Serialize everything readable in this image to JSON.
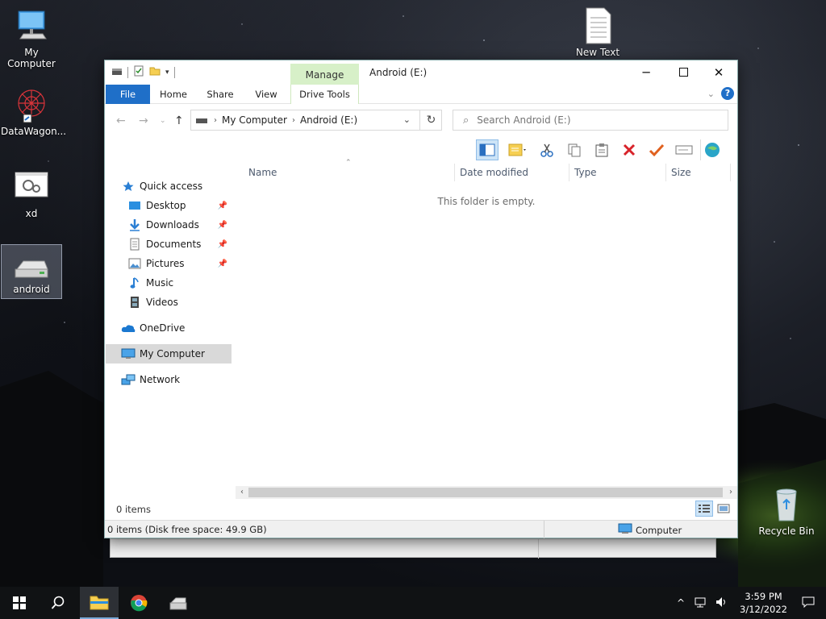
{
  "desktop": {
    "icons": [
      {
        "label": "My Computer"
      },
      {
        "label": "DataWagon..."
      },
      {
        "label": "xd"
      },
      {
        "label": "android"
      },
      {
        "label": "New Text"
      },
      {
        "label": "Recycle Bin"
      }
    ]
  },
  "window": {
    "title": "Android (E:)",
    "contextual_group": "Manage",
    "tabs": [
      "File",
      "Home",
      "Share",
      "View",
      "Drive Tools"
    ],
    "address": {
      "crumbs": [
        "My Computer",
        "Android (E:)"
      ]
    },
    "search": {
      "placeholder": "Search Android (E:)"
    },
    "nav_pane": {
      "quick_access": "Quick access",
      "items": [
        "Desktop",
        "Downloads",
        "Documents",
        "Pictures",
        "Music",
        "Videos"
      ],
      "onedrive": "OneDrive",
      "my_computer": "My Computer",
      "network": "Network"
    },
    "columns": [
      "Name",
      "Date modified",
      "Type",
      "Size"
    ],
    "empty_message": "This folder is empty.",
    "item_count": "0 items",
    "status": {
      "left": "0 items (Disk free space: 49.9 GB)",
      "right": "Computer"
    }
  },
  "taskbar": {
    "time": "3:59 PM",
    "date": "3/12/2022"
  },
  "colors": {
    "accent": "#1f6fc8",
    "manage_tab": "#d7f0c8",
    "selected_nav": "#d9d9d9"
  }
}
